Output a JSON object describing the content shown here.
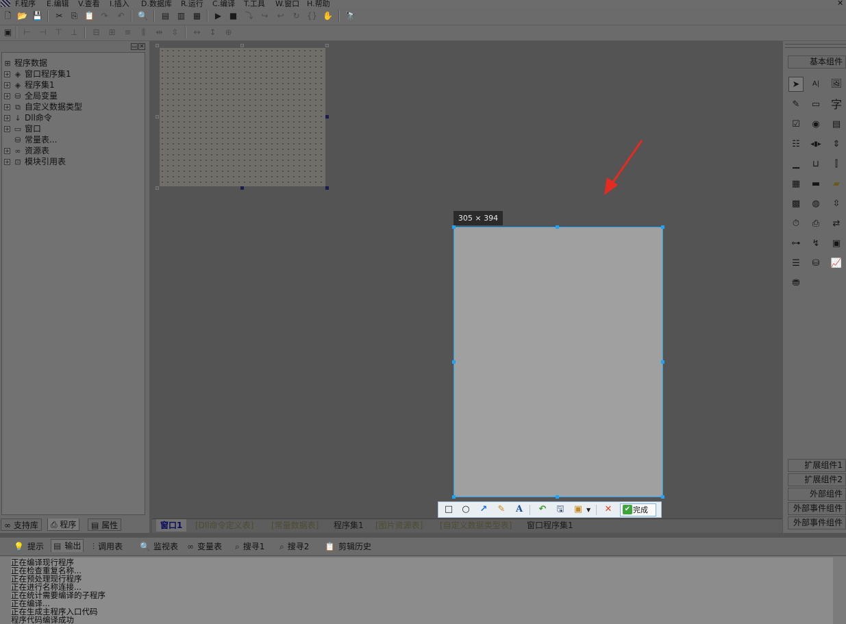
{
  "menubar": {
    "items": [
      "F.程序",
      "E.编辑",
      "V.查看",
      "I.插入",
      "D.数据库",
      "R.运行",
      "C.编译",
      "T.工具",
      "W.窗口",
      "H.帮助"
    ]
  },
  "left_panel": {
    "tree": [
      {
        "label": "程序数据",
        "icon": "program-data-icon"
      },
      {
        "label": "窗口程序集1",
        "icon": "window-assembly-icon"
      },
      {
        "label": "程序集1",
        "icon": "assembly-icon"
      },
      {
        "label": "全局变量",
        "icon": "global-variable-icon"
      },
      {
        "label": "自定义数据类型",
        "icon": "custom-type-icon"
      },
      {
        "label": "Dll命令",
        "icon": "dll-command-icon"
      },
      {
        "label": "窗口",
        "icon": "window-icon"
      },
      {
        "label": "常量表...",
        "icon": "constant-table-icon"
      },
      {
        "label": "资源表",
        "icon": "resource-table-icon"
      },
      {
        "label": "模块引用表",
        "icon": "module-reference-icon"
      }
    ],
    "tabs": [
      "支持库",
      "程序",
      "属性"
    ],
    "active_tab": "程序"
  },
  "capture": {
    "size_label": "305 × 394",
    "done_label": "完成"
  },
  "doc_tabs": {
    "items": [
      "窗口1",
      "[Dll命令定义表]",
      "[常量数据表]",
      "程序集1",
      "[图片资源表]",
      "[自定义数据类型表]",
      "窗口程序集1"
    ],
    "active": "窗口1"
  },
  "right_panel": {
    "header": "基本组件",
    "buttons": [
      "扩展组件1",
      "扩展组件2",
      "外部组件",
      "外部事件组件",
      "外部事件组件"
    ]
  },
  "bottom": {
    "tabs": [
      "提示",
      "输出",
      "调用表",
      "监视表",
      "变量表",
      "搜寻1",
      "搜寻2",
      "剪辑历史"
    ],
    "active_tab": "输出",
    "output_lines": [
      "正在编译现行程序",
      "正在检查重复名称...",
      "正在预处理现行程序",
      "正在进行名称连接...",
      "正在统计需要编译的子程序",
      "正在编译...",
      "正在生成主程序入口代码",
      "程序代码编译成功"
    ]
  },
  "colors": {
    "capture_border": "#20a3f5",
    "canvas_bg": "#545454",
    "arrow": "#e52b1f",
    "done_check": "#3da63a"
  }
}
